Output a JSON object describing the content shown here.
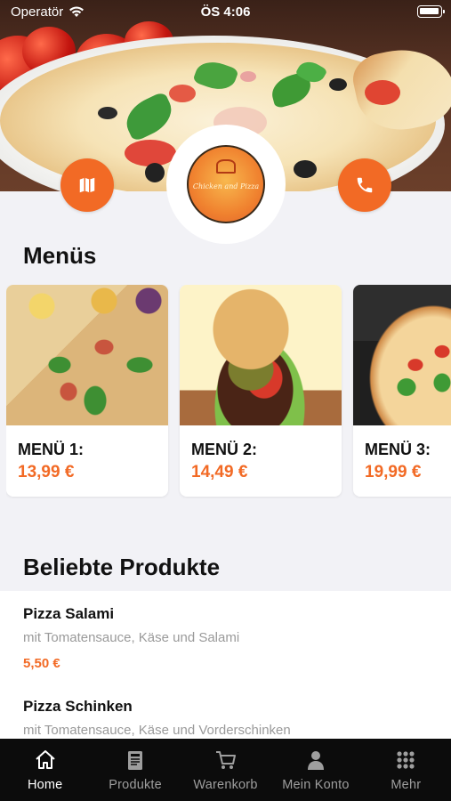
{
  "status_bar": {
    "carrier": "Operatör",
    "time": "ÖS 4:06"
  },
  "header": {
    "map_button_icon": "map-icon",
    "phone_button_icon": "phone-icon",
    "logo_text": "Chicken and Pizza",
    "accent_color": "#f26a25"
  },
  "menus": {
    "title": "Menüs",
    "items": [
      {
        "label": "MENÜ 1:",
        "price": "13,99 €"
      },
      {
        "label": "MENÜ 2:",
        "price": "14,49 €"
      },
      {
        "label": "MENÜ 3:",
        "price": "19,99 €"
      }
    ]
  },
  "popular": {
    "title": "Beliebte Produkte",
    "items": [
      {
        "name": "Pizza Salami",
        "description": "mit Tomatensauce, Käse und Salami",
        "price": "5,50 €"
      },
      {
        "name": "Pizza Schinken",
        "description": "mit Tomatensauce, Käse und Vorderschinken",
        "price": ""
      }
    ]
  },
  "tabbar": {
    "items": [
      {
        "label": "Home",
        "icon": "home-icon",
        "active": true
      },
      {
        "label": "Produkte",
        "icon": "menu-book-icon",
        "active": false
      },
      {
        "label": "Warenkorb",
        "icon": "cart-icon",
        "active": false
      },
      {
        "label": "Mein Konto",
        "icon": "user-icon",
        "active": false
      },
      {
        "label": "Mehr",
        "icon": "grid-icon",
        "active": false
      }
    ]
  }
}
